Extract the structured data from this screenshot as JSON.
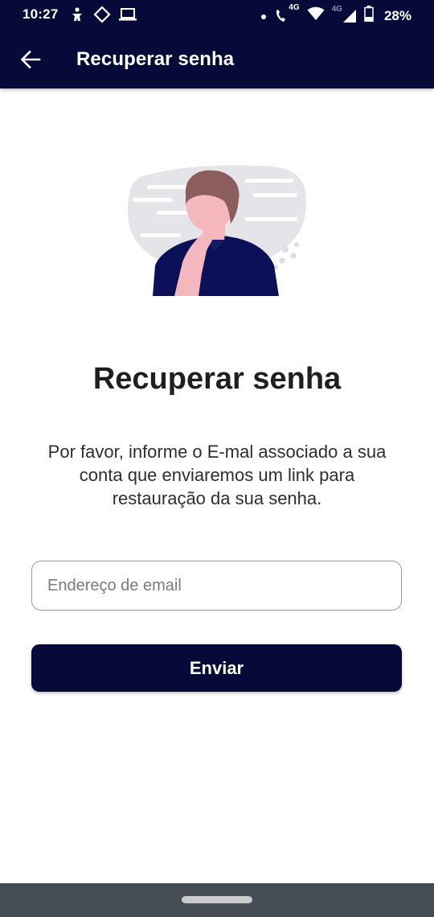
{
  "status_bar": {
    "time": "10:27",
    "battery": "28%",
    "network_label_1": "4G",
    "network_label_2": "4G",
    "icons": [
      "accessibility-icon",
      "diamond-nav-icon",
      "laptop-icon",
      "dot-icon",
      "wifi-calling-icon",
      "wifi-icon",
      "signal-icon",
      "battery-icon"
    ]
  },
  "app_bar": {
    "title": "Recuperar senha",
    "back_icon": "arrow-left-icon"
  },
  "illustration": {
    "description_icon": "thinking-person-illustration"
  },
  "content": {
    "heading": "Recuperar senha",
    "description": "Por favor, informe o E-mal associado a sua conta que enviaremos um link para restauração da sua senha."
  },
  "form": {
    "email_placeholder": "Endereço de email",
    "email_value": "",
    "submit_label": "Enviar"
  },
  "colors": {
    "primary": "#050a38",
    "navbar": "#464d54",
    "text": "#1f1f1f"
  }
}
